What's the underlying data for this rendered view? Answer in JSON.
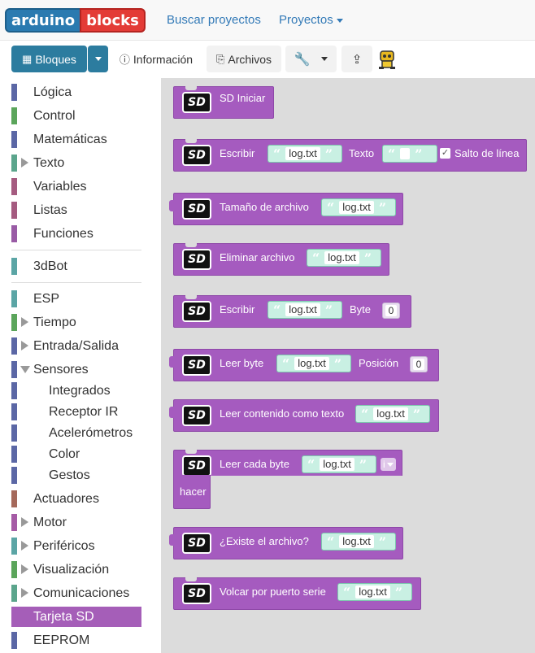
{
  "app": {
    "logo_part1": "arduino",
    "logo_part2": "blocks"
  },
  "nav": {
    "search_projects": "Buscar proyectos",
    "projects": "Proyectos"
  },
  "toolbar": {
    "blocks": "Bloques",
    "info": "Información",
    "files": "Archivos"
  },
  "sidebar": {
    "categories": [
      {
        "label": "Lógica",
        "color": "#5b67a5"
      },
      {
        "label": "Control",
        "color": "#5ba55b"
      },
      {
        "label": "Matemáticas",
        "color": "#5b67a5"
      },
      {
        "label": "Texto",
        "color": "#5ba58c"
      },
      {
        "label": "Variables",
        "color": "#a55b80"
      },
      {
        "label": "Listas",
        "color": "#a55b80"
      },
      {
        "label": "Funciones",
        "color": "#995ba5"
      },
      {
        "label": "3dBot",
        "color": "#5ba5a5"
      },
      {
        "label": "ESP",
        "color": "#5ba5a5"
      },
      {
        "label": "Tiempo",
        "color": "#5ba55b"
      },
      {
        "label": "Entrada/Salida",
        "color": "#5b67a5"
      },
      {
        "label": "Sensores",
        "color": "#5b67a5"
      },
      {
        "label": "Integrados",
        "color": "#5b67a5"
      },
      {
        "label": "Receptor IR",
        "color": "#5b67a5"
      },
      {
        "label": "Acelerómetros",
        "color": "#5b67a5"
      },
      {
        "label": "Color",
        "color": "#5b67a5"
      },
      {
        "label": "Gestos",
        "color": "#5b67a5"
      },
      {
        "label": "Actuadores",
        "color": "#a5695b"
      },
      {
        "label": "Motor",
        "color": "#a55ba5"
      },
      {
        "label": "Periféricos",
        "color": "#5ba5a5"
      },
      {
        "label": "Visualización",
        "color": "#5ba55b"
      },
      {
        "label": "Comunicaciones",
        "color": "#5ba58c"
      },
      {
        "label": "Tarjeta SD",
        "color": "#a55eb8"
      },
      {
        "label": "EEPROM",
        "color": "#5b67a5"
      }
    ]
  },
  "blocks": {
    "sd_init": "SD Iniciar",
    "write": "Escribir",
    "text_label": "Texto",
    "newline": "Salto de línea",
    "file_size": "Tamaño de archivo",
    "delete_file": "Eliminar archivo",
    "write_byte": "Escribir",
    "byte_label": "Byte",
    "byte_value": "0",
    "read_byte": "Leer byte",
    "position_label": "Posición",
    "position_value": "0",
    "read_text": "Leer contenido como texto",
    "read_each": "Leer cada byte",
    "var_i": "i",
    "do_label": "hacer",
    "file_exists": "¿Existe el archivo?",
    "dump_serial": "Volcar por puerto serie",
    "filename": "log.txt",
    "sd_logo": "SD"
  },
  "colors": {
    "block_purple": "#a55bbf",
    "workspace": "#dcdcdc",
    "primary": "#2c7c9f"
  }
}
